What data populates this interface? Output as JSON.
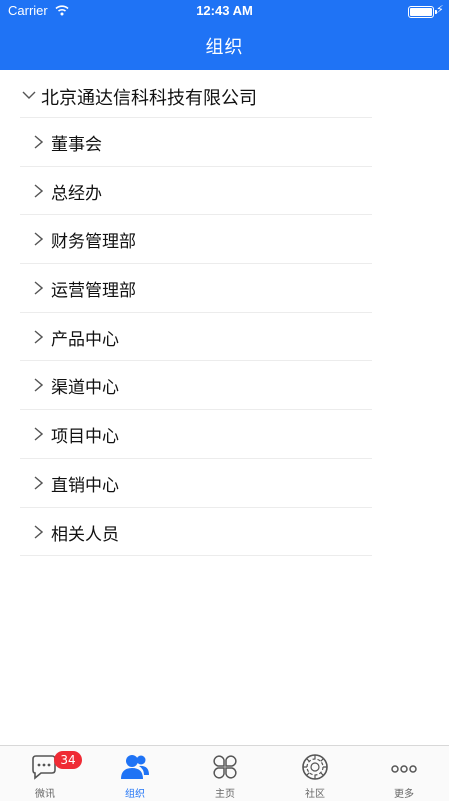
{
  "status_bar": {
    "carrier": "Carrier",
    "time": "12:43 AM"
  },
  "header": {
    "title": "组织"
  },
  "tree": {
    "company": "北京通达信科科技有限公司",
    "departments": [
      "董事会",
      "总经办",
      "财务管理部",
      "运营管理部",
      "产品中心",
      "渠道中心",
      "项目中心",
      "直销中心",
      "相关人员"
    ]
  },
  "tab_bar": {
    "tabs": [
      {
        "label": "微讯",
        "icon": "chat-icon",
        "badge": "34"
      },
      {
        "label": "组织",
        "icon": "people-icon",
        "active": true
      },
      {
        "label": "主页",
        "icon": "clover-icon"
      },
      {
        "label": "社区",
        "icon": "community-icon"
      },
      {
        "label": "更多",
        "icon": "more-dots-icon"
      }
    ]
  },
  "colors": {
    "brand": "#1f73f5",
    "badge": "#ef2b35"
  }
}
